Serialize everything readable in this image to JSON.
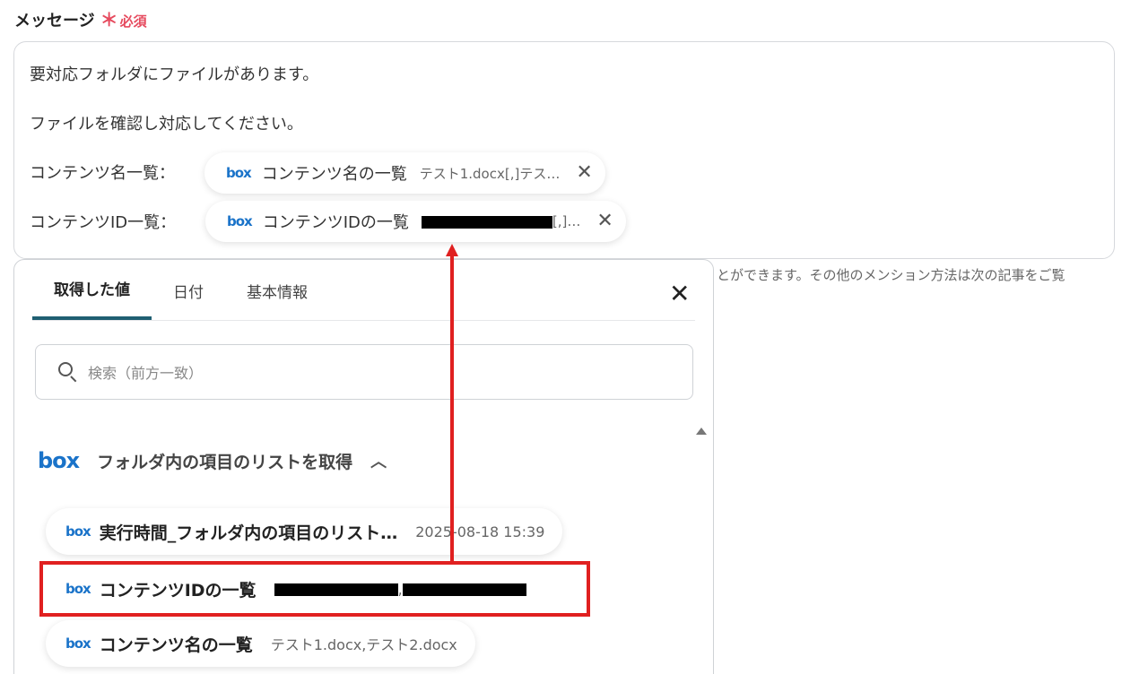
{
  "field": {
    "label": "メッセージ",
    "required_mark": "＊",
    "required_text": "必須"
  },
  "message": {
    "line1": "要対応フォルダにファイルがあります。",
    "line2": "ファイルを確認し対応してください。",
    "row3_prefix": "コンテンツ名一覧：",
    "row4_prefix": "コンテンツID一覧：",
    "chip_names": {
      "logo": "box",
      "label": "コンテンツ名の一覧",
      "value": "テスト1.docx[,]テス…"
    },
    "chip_ids": {
      "logo": "box",
      "label": "コンテンツIDの一覧",
      "value_suffix": "[,]…"
    }
  },
  "hint": "とができます。その他のメンション方法は次の記事をご覧",
  "panel": {
    "tabs": [
      {
        "label": "取得した値",
        "active": true
      },
      {
        "label": "日付",
        "active": false
      },
      {
        "label": "基本情報",
        "active": false
      }
    ],
    "search_placeholder": "検索（前方一致）",
    "group": {
      "logo": "box",
      "title": "フォルダ内の項目のリストを取得"
    },
    "items": [
      {
        "logo": "box",
        "label": "実行時間_フォルダ内の項目のリスト…",
        "value": "2025-08-18 15:39"
      },
      {
        "logo": "box",
        "label": "コンテンツIDの一覧",
        "value_separator": ","
      },
      {
        "logo": "box",
        "label": "コンテンツ名の一覧",
        "value": "テスト1.docx,テスト2.docx"
      }
    ]
  },
  "colors": {
    "required": "#e64a5e",
    "box_blue": "#1a73c9",
    "tab_underline": "#1f5f72",
    "annotation_red": "#e02020"
  },
  "icons": [
    "close-icon",
    "search-icon",
    "chevron-up-icon",
    "scroll-up-icon",
    "box-logo"
  ]
}
